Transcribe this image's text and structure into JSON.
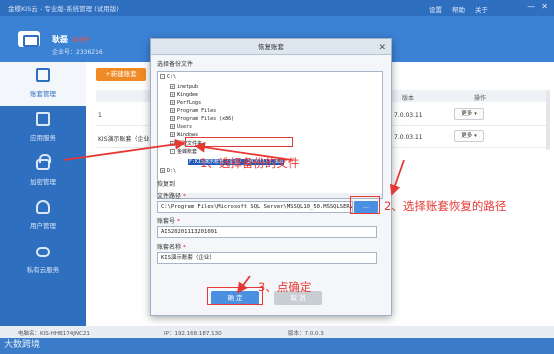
{
  "app": {
    "title": "金蝶KIS云 - 专业版-系统管理 (试用版)",
    "menu": [
      "设置",
      "帮助",
      "关于"
    ]
  },
  "header": {
    "user_name": "耿磊",
    "user_tag": "中间件",
    "corp_label": "企业号：2336216"
  },
  "sidebar": {
    "items": [
      {
        "label": "账套管理",
        "icon": "ledger-icon",
        "active": true
      },
      {
        "label": "应用服务",
        "icon": "app-service-icon"
      },
      {
        "label": "加密管理",
        "icon": "lock-icon"
      },
      {
        "label": "用户管理",
        "icon": "user-icon"
      },
      {
        "label": "私有云服务",
        "icon": "cloud-icon"
      }
    ]
  },
  "main": {
    "new_button": "+新建账套",
    "columns": {
      "version": "版本",
      "op": "操作"
    },
    "rows": [
      {
        "name": "1",
        "version": "7.0.03.11",
        "action": "更多"
      },
      {
        "name": "KIS演示账套（企业",
        "version": "7.0.03.11",
        "action": "更多"
      }
    ]
  },
  "status_bar": {
    "computer": "电脑名：KIS-HHB174JNC21",
    "ip": "IP：192.168.187.130",
    "version": "版本：7.0.0.3"
  },
  "watermark": "大数跨境",
  "dialog": {
    "title": "恢复账套",
    "select_label": "选择备份文件",
    "tree": [
      {
        "label": "C:\\",
        "depth": 0,
        "toggle": "-"
      },
      {
        "label": "inetpub",
        "depth": 1,
        "toggle": "+"
      },
      {
        "label": "Kingdee",
        "depth": 1,
        "toggle": "+"
      },
      {
        "label": "PerfLogs",
        "depth": 1,
        "toggle": "+"
      },
      {
        "label": "Program Files",
        "depth": 1,
        "toggle": "+"
      },
      {
        "label": "Program Files (x86)",
        "depth": 1,
        "toggle": "+"
      },
      {
        "label": "Users",
        "depth": 1,
        "toggle": "+"
      },
      {
        "label": "Windows",
        "depth": 1,
        "toggle": "+"
      },
      {
        "label": "新建文件夹",
        "depth": 1,
        "toggle": "+"
      },
      {
        "label": "金蝶账套",
        "depth": 1,
        "toggle": "-"
      },
      {
        "label": "F:KIS演示账套（企业）_20201113.dbb",
        "depth": 2,
        "toggle": "",
        "selected": true
      },
      {
        "label": "D:\\",
        "depth": 0,
        "toggle": "+"
      }
    ],
    "restore_to_label": "恢复到",
    "path_label": "文件路径",
    "path_value": "C:\\Program Files\\Microsoft SQL Server\\MSSQL10_50.MSSQLSERVER\\M",
    "browse_label": "...",
    "acct_no_label": "账套号",
    "acct_no_value": "AIS20201113201001",
    "acct_name_label": "账套名称",
    "acct_name_value": "KIS演示账套（企业）",
    "ok_label": "确 定",
    "cancel_label": "取 消",
    "close_glyph": "✕"
  },
  "annotations": {
    "step1": "1、选择备份的文件",
    "step2": "2、选择账套恢复的路径",
    "step3": "3、点确定",
    "color": "#e53935"
  }
}
